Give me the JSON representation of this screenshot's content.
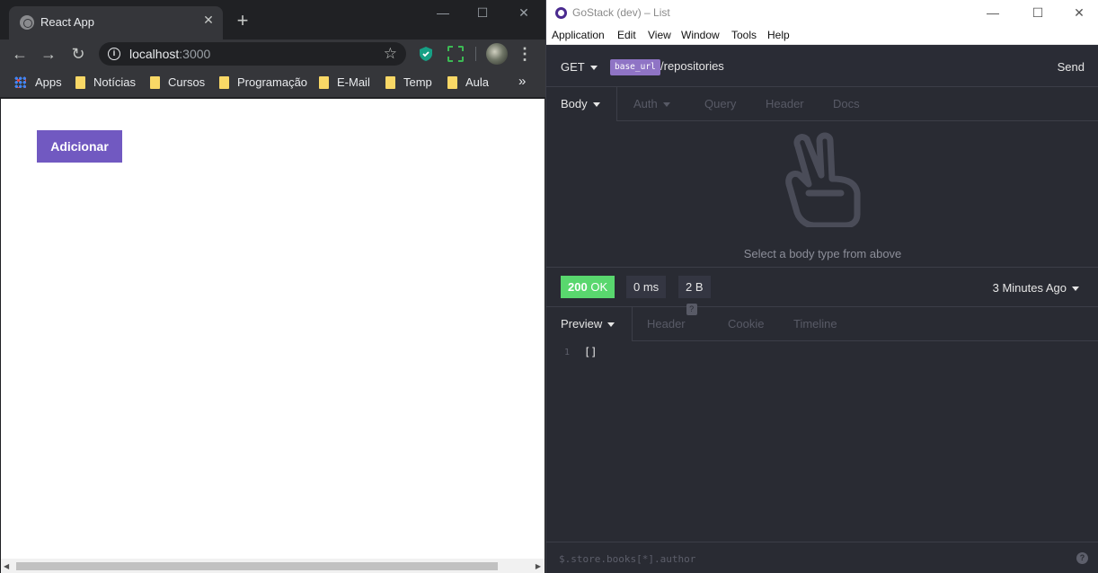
{
  "browser": {
    "tab_title": "React App",
    "url_host": "localhost",
    "url_port": ":3000",
    "bookmarks": [
      "Apps",
      "Notícias",
      "Cursos",
      "Programação",
      "E-Mail",
      "Temp",
      "Aula"
    ],
    "more_bookmarks": "»"
  },
  "app": {
    "add_button_label": "Adicionar",
    "add_button_color": "#7159c1"
  },
  "insomnia": {
    "window_title": "GoStack (dev) – List",
    "menu": [
      "Application",
      "Edit",
      "View",
      "Window",
      "Tools",
      "Help"
    ],
    "method": "GET",
    "base_url_tag": "base_url",
    "url_path": "/repositories",
    "send_label": "Send",
    "request_tabs": [
      "Body",
      "Auth",
      "Query",
      "Header",
      "Docs"
    ],
    "empty_body_text": "Select a body type from above",
    "status_code": "200",
    "status_text": "OK",
    "status_color": "#59d76e",
    "time": "0 ms",
    "size": "2 B",
    "time_ago": "3 Minutes Ago",
    "response_tabs": [
      "Preview",
      "Header",
      "Cookie",
      "Timeline"
    ],
    "header_badge": "?",
    "response_lines": [
      {
        "no": "1",
        "code": "[]"
      }
    ],
    "filter_placeholder": "$.store.books[*].author",
    "help_icon": "?"
  }
}
